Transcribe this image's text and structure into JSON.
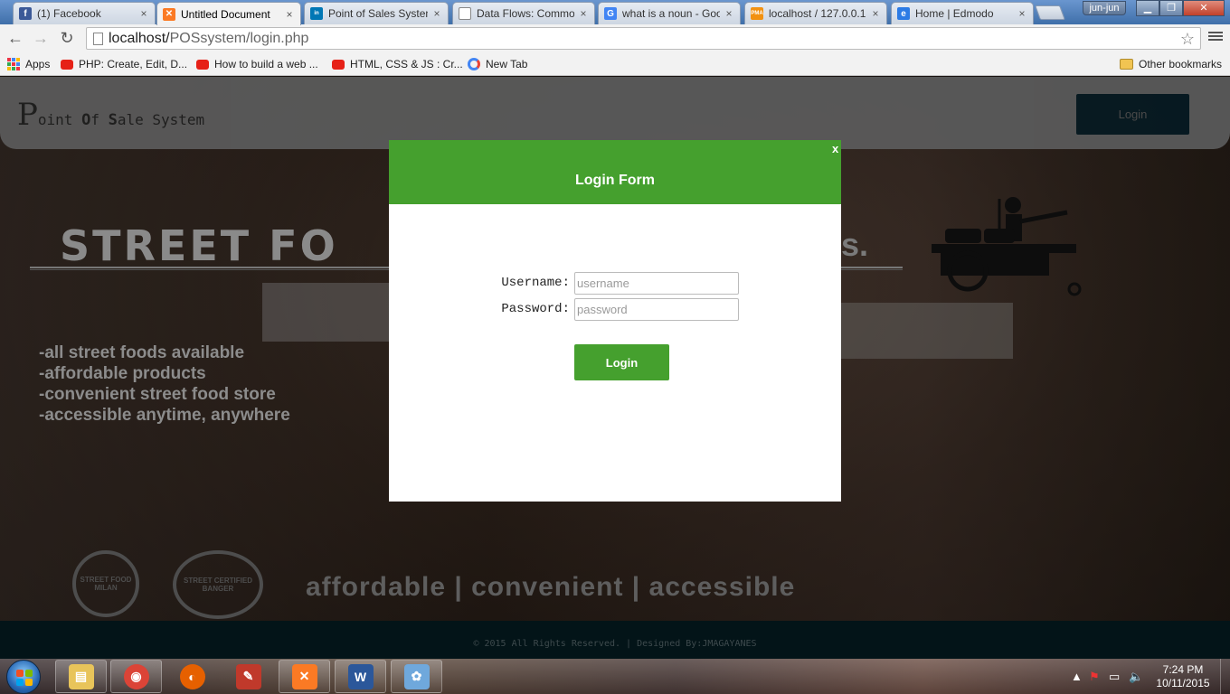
{
  "browser": {
    "tabs": [
      {
        "label": "(1) Facebook",
        "icon": "facebook-icon",
        "color": "#3b5998",
        "glyph": "f"
      },
      {
        "label": "Untitled Document",
        "icon": "xampp-icon",
        "color": "#fb7a24",
        "glyph": "✕"
      },
      {
        "label": "Point of Sales System",
        "icon": "linkedin-icon",
        "color": "#0077b5",
        "glyph": "in"
      },
      {
        "label": "Data Flows: Common",
        "icon": "document-icon",
        "color": "#ffffff",
        "glyph": ""
      },
      {
        "label": "what is a noun - Google",
        "icon": "google-icon",
        "color": "#4285f4",
        "glyph": "G"
      },
      {
        "label": "localhost / 127.0.0.1",
        "icon": "phpmyadmin-icon",
        "color": "#f29111",
        "glyph": "PMA"
      },
      {
        "label": "Home | Edmodo",
        "icon": "edmodo-icon",
        "color": "#2c7be5",
        "glyph": "e"
      }
    ],
    "tab_close_glyph": "×",
    "user": "jun-jun",
    "window_buttons": {
      "minimize": "▁",
      "maximize": "❐",
      "close": "✕"
    },
    "nav": {
      "back": "←",
      "forward": "→",
      "reload": "↻"
    },
    "url_host": "localhost/",
    "url_path": "POSsystem/login.php",
    "star_glyph": "☆",
    "bookmarks": [
      {
        "label": "Apps",
        "icon": "apps-grid-icon"
      },
      {
        "label": "PHP: Create, Edit, D...",
        "icon": "youtube-icon"
      },
      {
        "label": "How to build a web ...",
        "icon": "youtube-icon"
      },
      {
        "label": "HTML, CSS & JS : Cr...",
        "icon": "youtube-icon"
      },
      {
        "label": "New Tab",
        "icon": "google-icon"
      }
    ],
    "other_bookmarks": "Other bookmarks"
  },
  "site": {
    "brand": {
      "p": "P",
      "oint": "oint ",
      "o": "O",
      "f": "f ",
      "s": "S",
      "ale": "ale System"
    },
    "header_login": "Login",
    "promo_title": "STREET FO",
    "promo_title_tail": "s.",
    "features": [
      "-all street foods available",
      "-affordable products",
      "-convenient street food store",
      "-accessible anytime, anywhere"
    ],
    "seal_left": "STREET FOOD MILAN",
    "seal_right": "STREET CERTIFIED BANGER",
    "slogan": "affordable | convenient | accessible",
    "footer": "© 2015 All Rights Reserved. | Designed By:JMAGAYANES"
  },
  "modal": {
    "title": "Login Form",
    "close": "x",
    "username_label": "Username:",
    "username_placeholder": "username",
    "password_label": "Password:",
    "password_placeholder": "password",
    "submit": "Login",
    "accent": "#45a02e"
  },
  "taskbar": {
    "apps": [
      {
        "name": "explorer-icon",
        "color": "#e8c45a",
        "glyph": "▤"
      },
      {
        "name": "chrome-icon",
        "color": "#db4437",
        "glyph": "◉"
      },
      {
        "name": "firefox-icon",
        "color": "#e66000",
        "glyph": "◐"
      },
      {
        "name": "ccleaner-icon",
        "color": "#c0392b",
        "glyph": "✎"
      },
      {
        "name": "xampp-icon",
        "color": "#fb7a24",
        "glyph": "✕"
      },
      {
        "name": "word-icon",
        "color": "#2b579a",
        "glyph": "W"
      },
      {
        "name": "paint-icon",
        "color": "#6fa8dc",
        "glyph": "✿"
      }
    ],
    "time": "7:24 PM",
    "date": "10/11/2015"
  }
}
